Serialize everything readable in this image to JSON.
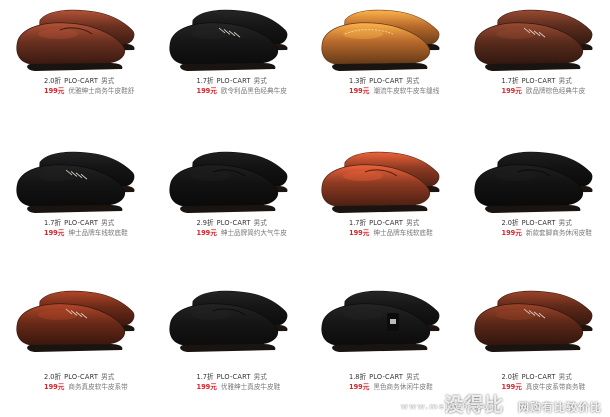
{
  "products": [
    {
      "discount": "2.0折",
      "brand": "PLO-CART",
      "gender": "男式",
      "price": "199元",
      "desc": "优雅绅士商务牛皮鞋舒",
      "color": "#6a3020",
      "style": "loafer"
    },
    {
      "discount": "1.7折",
      "brand": "PLO-CART",
      "gender": "男式",
      "price": "199元",
      "desc": "欧令利品黑色经典牛皮",
      "color": "#161616",
      "style": "derby"
    },
    {
      "discount": "1.3折",
      "brand": "PLO-CART",
      "gender": "男式",
      "price": "199元",
      "desc": "潮流牛皮软牛皮车缝线",
      "color": "#b86a2c",
      "style": "casual"
    },
    {
      "discount": "1.7折",
      "brand": "PLO-CART",
      "gender": "男式",
      "price": "199元",
      "desc": "欧品牌棕色经典牛皮",
      "color": "#5a2c1d",
      "style": "derby"
    },
    {
      "discount": "1.7折",
      "brand": "PLO-CART",
      "gender": "男式",
      "price": "199元",
      "desc": "绅士品牌车线软底鞋",
      "color": "#141414",
      "style": "lace"
    },
    {
      "discount": "2.9折",
      "brand": "PLO-CART",
      "gender": "男式",
      "price": "199元",
      "desc": "绅士品牌简约大气牛皮",
      "color": "#121212",
      "style": "loafer"
    },
    {
      "discount": "1.7折",
      "brand": "PLO-CART",
      "gender": "男式",
      "price": "199元",
      "desc": "绅士品牌车线软底鞋",
      "color": "#8c3a22",
      "style": "loafer"
    },
    {
      "discount": "2.0折",
      "brand": "PLO-CART",
      "gender": "男式",
      "price": "199元",
      "desc": "新款套脚商务休闲皮鞋",
      "color": "#121212",
      "style": "loafer"
    },
    {
      "discount": "2.0折",
      "brand": "PLO-CART",
      "gender": "男式",
      "price": "199元",
      "desc": "商务真皮软牛皮系带",
      "color": "#6a2a18",
      "style": "lace"
    },
    {
      "discount": "1.7折",
      "brand": "PLO-CART",
      "gender": "男式",
      "price": "199元",
      "desc": "优雅绅士真皮牛皮鞋",
      "color": "#151515",
      "style": "loafer"
    },
    {
      "discount": "1.8折",
      "brand": "PLO-CART",
      "gender": "男式",
      "price": "199元",
      "desc": "黑色商务休闲牛皮鞋",
      "color": "#161616",
      "style": "strap"
    },
    {
      "discount": "2.0折",
      "brand": "PLO-CART",
      "gender": "男式",
      "price": "199元",
      "desc": "真皮牛皮系带商务鞋",
      "color": "#5c2818",
      "style": "lace"
    }
  ],
  "watermark": {
    "main": "没得比",
    "sub": "www.meidebi.com",
    "tail": "网购有比较价比"
  },
  "colors": {
    "price": "#d6232c",
    "text": "#444444",
    "background": "#ffffff"
  }
}
